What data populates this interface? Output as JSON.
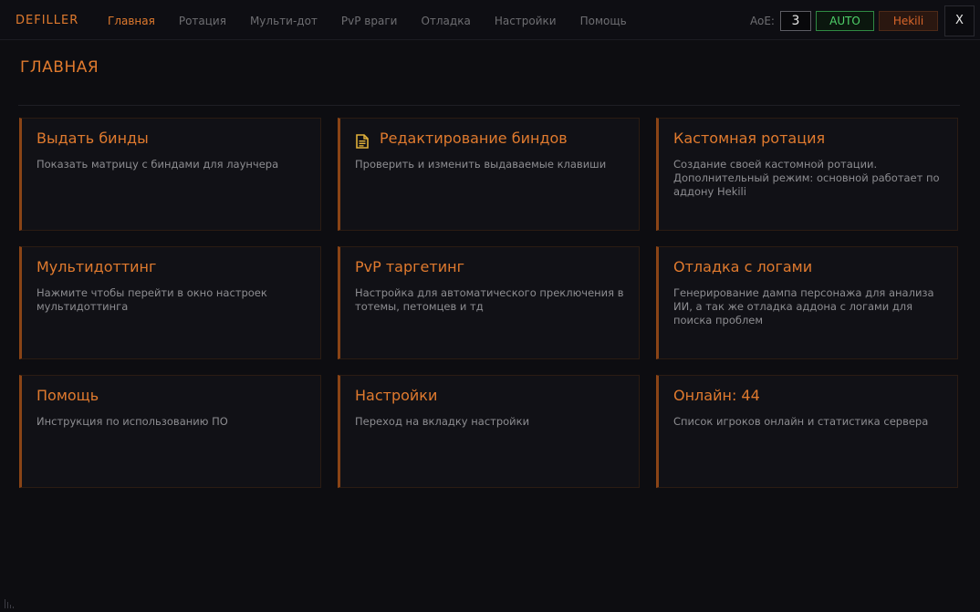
{
  "app": {
    "title": "DEFILLER"
  },
  "nav": {
    "items": [
      {
        "label": "Главная",
        "active": true
      },
      {
        "label": "Ротация",
        "active": false
      },
      {
        "label": "Мульти-дот",
        "active": false
      },
      {
        "label": "PvP враги",
        "active": false
      },
      {
        "label": "Отладка",
        "active": false
      },
      {
        "label": "Настройки",
        "active": false
      },
      {
        "label": "Помощь",
        "active": false
      }
    ]
  },
  "controls": {
    "aoe_label": "AoE:",
    "aoe_value": "3",
    "auto_label": "AUTO",
    "hekili_label": "Hekili",
    "close_label": "X"
  },
  "page": {
    "title": "ГЛАВНАЯ"
  },
  "cards": [
    {
      "title": "Выдать бинды",
      "desc": "Показать матрицу с биндами для лаунчера",
      "icon": null
    },
    {
      "title": "Редактирование биндов",
      "desc": "Проверить и изменить выдаваемые клавиши",
      "icon": "document-icon"
    },
    {
      "title": "Кастомная ротация",
      "desc": "Создание своей кастомной ротации. Дополнительный режим: основной работает по аддону Hekili",
      "icon": null
    },
    {
      "title": "Мультидоттинг",
      "desc": "Нажмите чтобы перейти в окно настроек мультидоттинга",
      "icon": null
    },
    {
      "title": "PvP таргетинг",
      "desc": "Настройка для автоматического преключения в тотемы, петомцев и тд",
      "icon": null
    },
    {
      "title": "Отладка с логами",
      "desc": "Генерирование дампа персонажа для анализа ИИ, а так же отладка аддона с логами для поиска проблем",
      "icon": null
    },
    {
      "title": "Помощь",
      "desc": "Инструкция по использованию ПО",
      "icon": null
    },
    {
      "title": "Настройки",
      "desc": "Переход на вкладку настройки",
      "icon": null
    },
    {
      "title": "Онлайн: 44",
      "desc": "Список игроков онлайн и статистика сервера",
      "icon": null
    }
  ],
  "colors": {
    "accent": "#e07a2e",
    "auto_green": "#4fd26a",
    "background": "#0d0d11",
    "card_border": "#8a4416"
  }
}
